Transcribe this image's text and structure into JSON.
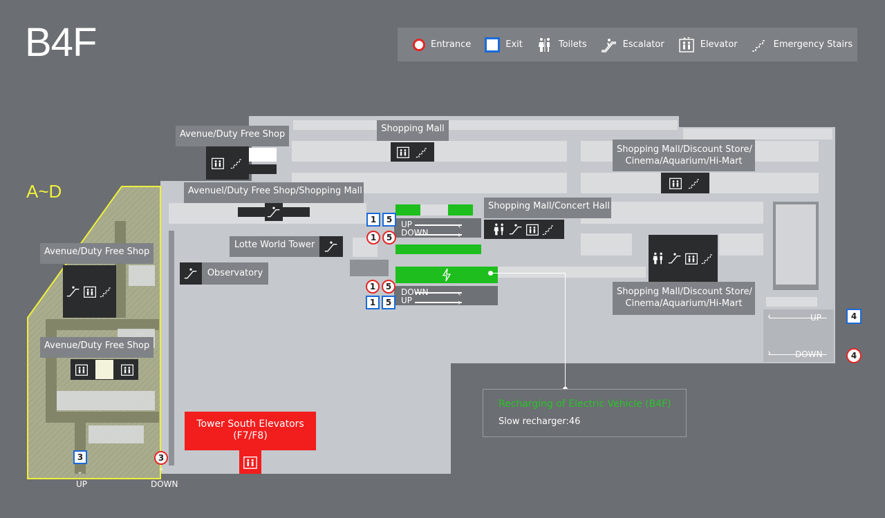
{
  "floor": "B4F",
  "zone_label": "A~D",
  "legend": {
    "entrance": "Entrance",
    "exit": "Exit",
    "toilets": "Toilets",
    "escalator": "Escalator",
    "elevator": "Elevator",
    "stairs": "Emergency Stairs"
  },
  "labels": {
    "avenue_duty_free_top": "Avenue/Duty Free Shop",
    "shopping_mall_top": "Shopping Mall",
    "avenue_duty_free_mall": "Avenuel/Duty Free Shop/Shopping Mall",
    "shopping_mall_concert": "Shopping Mall/Concert Hall",
    "discount_top_line1": "Shopping Mall/Discount Store/",
    "discount_top_line2": "Cinema/Aquarium/Hi-Mart",
    "discount_bottom_line1": "Shopping Mall/Discount Store/",
    "discount_bottom_line2": "Cinema/Aquarium/Hi-Mart",
    "lotte_tower": "Lotte World Tower",
    "observatory": "Observatory",
    "avenue_left_1": "Avenue/Duty Free Shop",
    "avenue_left_2": "Avenue/Duty Free Shop",
    "tower_south_line1": "Tower South Elevators",
    "tower_south_line2": "(F7/F8)"
  },
  "ramps": {
    "center_top": {
      "up": "UP",
      "down": "DOWN",
      "exit_nums": [
        "1",
        "5"
      ],
      "entrance_nums": [
        "1",
        "5"
      ]
    },
    "center_bottom": {
      "down": "DOWN",
      "up": "UP",
      "entrance_nums": [
        "1",
        "5"
      ],
      "exit_nums": [
        "1",
        "5"
      ]
    },
    "right": {
      "up": "UP",
      "down": "DOWN",
      "exit_num": "4",
      "entrance_num": "4"
    },
    "left": {
      "up": "UP",
      "down": "DOWN",
      "exit_num": "3",
      "entrance_num": "3"
    }
  },
  "ev_info": {
    "title": "Recharging of Electric Vehicle (B4F)",
    "detail": "Slow recharger:46"
  },
  "colors": {
    "background": "#6b6e72",
    "mall_floor": "#c5c8cc",
    "zone_outline": "#eef03a",
    "entrance": "#e32626",
    "exit": "#1a6ad8",
    "ev_green": "#1dbe1d",
    "tower_south": "#f21d1d"
  }
}
